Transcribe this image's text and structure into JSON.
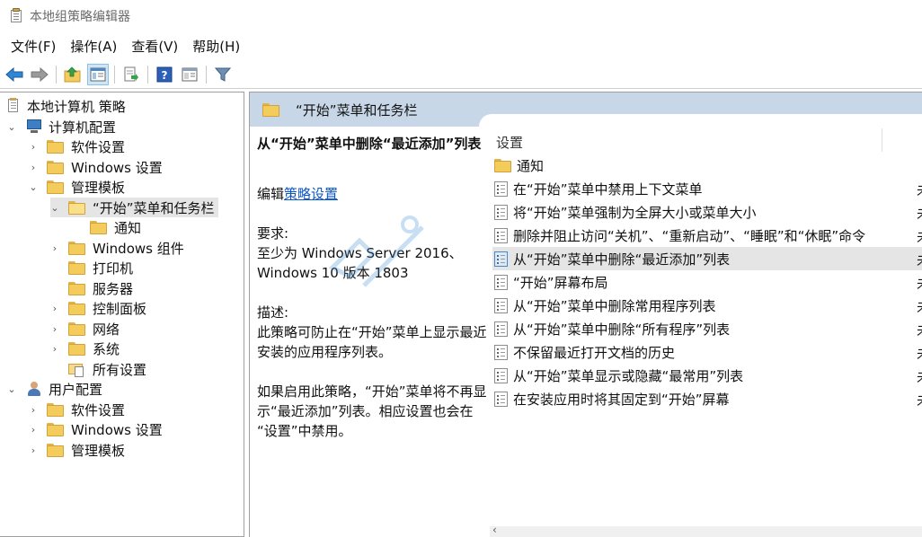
{
  "window": {
    "title": "本地组策略编辑器"
  },
  "menu": [
    "文件(F)",
    "操作(A)",
    "查看(V)",
    "帮助(H)"
  ],
  "toolbar": {
    "icons": [
      "back-arrow-icon",
      "forward-arrow-icon",
      "up-folder-icon",
      "show-hide-tree-icon",
      "export-list-icon",
      "help-icon",
      "properties-icon",
      "filter-icon"
    ]
  },
  "tree": {
    "root": "本地计算机 策略",
    "computer_config": "计算机配置",
    "software_settings": "软件设置",
    "windows_settings": "Windows 设置",
    "admin_templates": "管理模板",
    "start_menu_taskbar": "“开始”菜单和任务栏",
    "notifications": "通知",
    "windows_components": "Windows 组件",
    "printers": "打印机",
    "server": "服务器",
    "control_panel": "控制面板",
    "network": "网络",
    "system": "系统",
    "all_settings": "所有设置",
    "user_config": "用户配置",
    "user_software_settings": "软件设置",
    "user_windows_settings": "Windows 设置",
    "user_admin_templates": "管理模板"
  },
  "header": {
    "title": "“开始”菜单和任务栏"
  },
  "description": {
    "title": "从“开始”菜单中删除“最近添加”列表",
    "edit_prefix": "编辑",
    "edit_link": "策略设置",
    "requirements_label": "要求:",
    "requirements_line1": "至少为 Windows Server 2016、",
    "requirements_line2": "Windows 10 版本 1803",
    "description_label": "描述:",
    "desc_line1": "此策略可防止在“开始”菜单上显示最近",
    "desc_line2": "安装的应用程序列表。",
    "enable_line1": "如果启用此策略，“开始”菜单将不再显",
    "enable_line2": "示“最近添加”列表。相应设置也会在",
    "enable_line3": "“设置”中禁用。"
  },
  "list": {
    "column_setting": "设置",
    "folder_item": "通知",
    "items": [
      "在“开始”菜单中禁用上下文菜单",
      "将“开始”菜单强制为全屏大小或菜单大小",
      "删除并阻止访问“关机”、“重新启动”、“睡眠”和“休眠”命令",
      "从“开始”菜单中删除“最近添加”列表",
      "“开始”屏幕布局",
      "从“开始”菜单中删除常用程序列表",
      "从“开始”菜单中删除“所有程序”列表",
      "不保留最近打开文档的历史",
      "从“开始”菜单显示或隐藏“最常用”列表",
      "在安装应用时将其固定到“开始”屏幕"
    ],
    "state_glyph": "未",
    "selected_index": 3
  },
  "colors": {
    "header_band": "#c8d7e8",
    "selection": "#e5e5e5",
    "link": "#0b57c8",
    "folder": "#f3cc5c"
  }
}
